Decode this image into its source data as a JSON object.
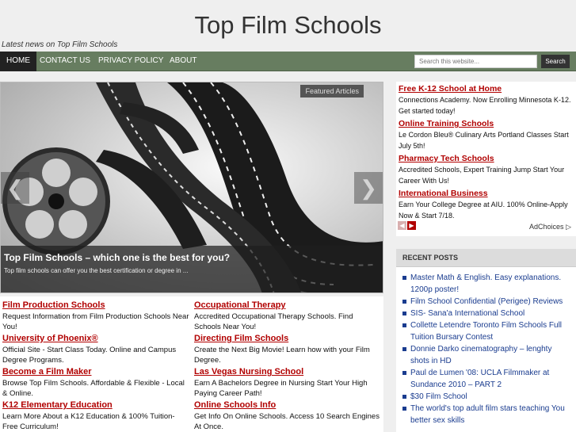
{
  "site": {
    "title": "Top Film Schools",
    "tagline": "Latest news on Top Film Schools"
  },
  "nav": {
    "items": [
      {
        "label": "HOME",
        "active": true
      },
      {
        "label": "CONTACT US",
        "active": false
      },
      {
        "label": "PRIVACY POLICY",
        "active": false
      },
      {
        "label": "ABOUT",
        "active": false
      }
    ]
  },
  "search": {
    "placeholder": "Search this website...",
    "button": "Search"
  },
  "slider": {
    "featured_label": "Featured Articles",
    "prev_icon": "arrow-left-icon",
    "next_icon": "arrow-right-icon",
    "caption_title": "Top Film Schools – which one is the best for you?",
    "caption_text": "Top film schools can offer you the best certification or degree in ..."
  },
  "ads_main": {
    "left": [
      {
        "title": "Film Production Schools",
        "text": "Request Information from Film Production Schools Near You!"
      },
      {
        "title": "University of Phoenix®",
        "text": "Official Site - Start Class Today. Online and Campus Degree Programs."
      },
      {
        "title": "Become a Film Maker",
        "text": "Browse Top Film Schools. Affordable & Flexible - Local & Online."
      },
      {
        "title": "K12 Elementary Education",
        "text": "Learn More About a K12 Education & 100% Tuition-Free Curriculum!"
      }
    ],
    "right": [
      {
        "title": "Occupational Therapy",
        "text": "Accredited Occupational Therapy Schools. Find Schools Near You!"
      },
      {
        "title": "Directing Film Schools",
        "text": "Create the Next Big Movie! Learn how with your Film Degree."
      },
      {
        "title": "Las Vegas Nursing School",
        "text": "Earn A Bachelors Degree in Nursing Start Your High Paying Career Path!"
      },
      {
        "title": "Online Schools Info",
        "text": "Get Info On Online Schools. Access 10 Search Engines At Once."
      }
    ]
  },
  "ads_sidebar": {
    "items": [
      {
        "title": "Free K-12 School at Home",
        "text": "Connections Academy. Now Enrolling Minnesota K-12. Get started today!"
      },
      {
        "title": "Online Training Schools",
        "text": "Le Cordon Bleu® Culinary Arts Portland Classes Start July 5th!"
      },
      {
        "title": "Pharmacy Tech Schools",
        "text": "Accredited Schools, Expert Training Jump Start Your Career With Us!"
      },
      {
        "title": "International Business",
        "text": "Earn Your College Degree at AIU. 100% Online-Apply Now & Start 7/18."
      }
    ],
    "prev_icon": "chevron-left-icon",
    "next_icon": "chevron-right-icon",
    "adchoices": "AdChoices"
  },
  "recent_posts": {
    "heading": "RECENT POSTS",
    "items": [
      "Master Math & English. Easy explanations. 1200p poster!",
      "Film School Confidential (Perigee) Reviews",
      "SIS- Sana'a International School",
      "Collette Letendre Toronto Film Schools Full Tuition Bursary Contest",
      "Donnie Darko cinematography – lenghty shots in HD",
      "Paul de Lumen '08: UCLA Filmmaker at Sundance 2010 – PART 2",
      "$30 Film School",
      "The world's top adult film stars teaching You better sex skills"
    ]
  }
}
